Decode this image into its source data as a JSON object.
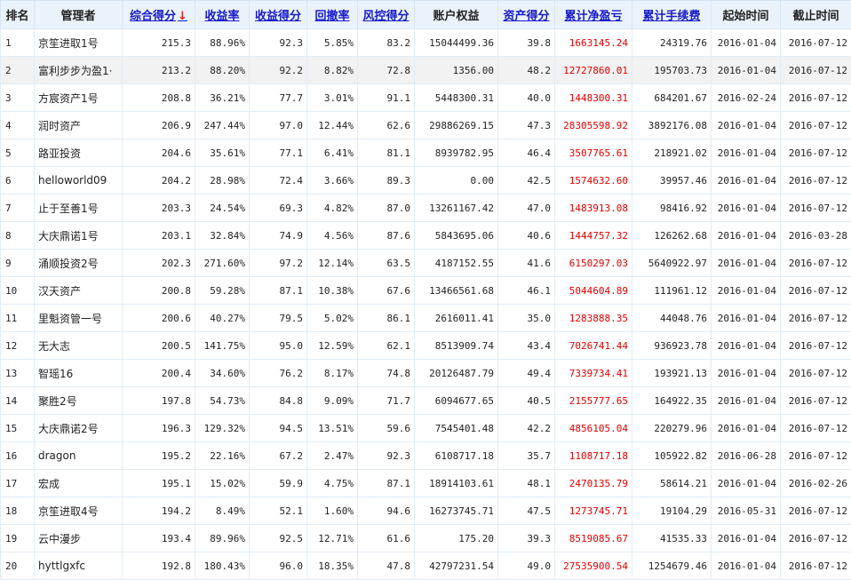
{
  "headers": {
    "rank": "排名",
    "manager": "管理者",
    "composite": "综合得分",
    "composite_arrow": "↓",
    "return_rate": "收益率",
    "return_score": "收益得分",
    "drawdown": "回撤率",
    "risk_score": "风控得分",
    "equity": "账户权益",
    "asset_score": "资产得分",
    "cum_pnl": "累计净盈亏",
    "cum_fee": "累计手续费",
    "start": "起始时间",
    "end": "截止时间"
  },
  "colors": {
    "header_bg": "#eaf3fc",
    "sort_link": "#1919c8",
    "arrow": "#e02020",
    "pnl_red": "#e00000",
    "highlight_row": "#f2f2f2"
  },
  "highlighted_row": 2,
  "rows": [
    {
      "rank": "1",
      "manager": "京笙进取1号",
      "composite": "215.3",
      "return_rate": "88.96%",
      "return_score": "92.3",
      "drawdown": "5.85%",
      "risk_score": "83.2",
      "equity": "15044499.36",
      "asset_score": "39.8",
      "cum_pnl": "1663145.24",
      "cum_fee": "24319.76",
      "start": "2016-01-04",
      "end": "2016-07-12"
    },
    {
      "rank": "2",
      "manager": "富利步步为盈1·",
      "composite": "213.2",
      "return_rate": "88.20%",
      "return_score": "92.2",
      "drawdown": "8.82%",
      "risk_score": "72.8",
      "equity": "1356.00",
      "asset_score": "48.2",
      "cum_pnl": "12727860.01",
      "cum_fee": "195703.73",
      "start": "2016-01-04",
      "end": "2016-07-12"
    },
    {
      "rank": "3",
      "manager": "方宸资产1号",
      "composite": "208.8",
      "return_rate": "36.21%",
      "return_score": "77.7",
      "drawdown": "3.01%",
      "risk_score": "91.1",
      "equity": "5448300.31",
      "asset_score": "40.0",
      "cum_pnl": "1448300.31",
      "cum_fee": "684201.67",
      "start": "2016-02-24",
      "end": "2016-07-12"
    },
    {
      "rank": "4",
      "manager": "润时资产",
      "composite": "206.9",
      "return_rate": "247.44%",
      "return_score": "97.0",
      "drawdown": "12.44%",
      "risk_score": "62.6",
      "equity": "29886269.15",
      "asset_score": "47.3",
      "cum_pnl": "28305598.92",
      "cum_fee": "3892176.08",
      "start": "2016-01-04",
      "end": "2016-07-12"
    },
    {
      "rank": "5",
      "manager": "路亚投资",
      "composite": "204.6",
      "return_rate": "35.61%",
      "return_score": "77.1",
      "drawdown": "6.41%",
      "risk_score": "81.1",
      "equity": "8939782.95",
      "asset_score": "46.4",
      "cum_pnl": "3507765.61",
      "cum_fee": "218921.02",
      "start": "2016-01-04",
      "end": "2016-07-12"
    },
    {
      "rank": "6",
      "manager": "helloworld09",
      "composite": "204.2",
      "return_rate": "28.98%",
      "return_score": "72.4",
      "drawdown": "3.66%",
      "risk_score": "89.3",
      "equity": "0.00",
      "asset_score": "42.5",
      "cum_pnl": "1574632.60",
      "cum_fee": "39957.46",
      "start": "2016-01-04",
      "end": "2016-07-12"
    },
    {
      "rank": "7",
      "manager": "止于至善1号",
      "composite": "203.3",
      "return_rate": "24.54%",
      "return_score": "69.3",
      "drawdown": "4.82%",
      "risk_score": "87.0",
      "equity": "13261167.42",
      "asset_score": "47.0",
      "cum_pnl": "1483913.08",
      "cum_fee": "98416.92",
      "start": "2016-01-04",
      "end": "2016-07-12"
    },
    {
      "rank": "8",
      "manager": "大庆鼎诺1号",
      "composite": "203.1",
      "return_rate": "32.84%",
      "return_score": "74.9",
      "drawdown": "4.56%",
      "risk_score": "87.6",
      "equity": "5843695.06",
      "asset_score": "40.6",
      "cum_pnl": "1444757.32",
      "cum_fee": "126262.68",
      "start": "2016-01-04",
      "end": "2016-03-28"
    },
    {
      "rank": "9",
      "manager": "涌顺投资2号",
      "composite": "202.3",
      "return_rate": "271.60%",
      "return_score": "97.2",
      "drawdown": "12.14%",
      "risk_score": "63.5",
      "equity": "4187152.55",
      "asset_score": "41.6",
      "cum_pnl": "6150297.03",
      "cum_fee": "5640922.97",
      "start": "2016-01-04",
      "end": "2016-07-12"
    },
    {
      "rank": "10",
      "manager": "汉天资产",
      "composite": "200.8",
      "return_rate": "59.28%",
      "return_score": "87.1",
      "drawdown": "10.38%",
      "risk_score": "67.6",
      "equity": "13466561.68",
      "asset_score": "46.1",
      "cum_pnl": "5044604.89",
      "cum_fee": "111961.12",
      "start": "2016-01-04",
      "end": "2016-07-12"
    },
    {
      "rank": "11",
      "manager": "里魁资管一号",
      "composite": "200.6",
      "return_rate": "40.27%",
      "return_score": "79.5",
      "drawdown": "5.02%",
      "risk_score": "86.1",
      "equity": "2616011.41",
      "asset_score": "35.0",
      "cum_pnl": "1283888.35",
      "cum_fee": "44048.76",
      "start": "2016-01-04",
      "end": "2016-07-12"
    },
    {
      "rank": "12",
      "manager": "无大志",
      "composite": "200.5",
      "return_rate": "141.75%",
      "return_score": "95.0",
      "drawdown": "12.59%",
      "risk_score": "62.1",
      "equity": "8513909.74",
      "asset_score": "43.4",
      "cum_pnl": "7026741.44",
      "cum_fee": "936923.78",
      "start": "2016-01-04",
      "end": "2016-07-12"
    },
    {
      "rank": "13",
      "manager": "智瑶16",
      "composite": "200.4",
      "return_rate": "34.60%",
      "return_score": "76.2",
      "drawdown": "8.17%",
      "risk_score": "74.8",
      "equity": "20126487.79",
      "asset_score": "49.4",
      "cum_pnl": "7339734.41",
      "cum_fee": "193921.13",
      "start": "2016-01-04",
      "end": "2016-07-12"
    },
    {
      "rank": "14",
      "manager": "聚胜2号",
      "composite": "197.8",
      "return_rate": "54.73%",
      "return_score": "84.8",
      "drawdown": "9.09%",
      "risk_score": "71.7",
      "equity": "6094677.65",
      "asset_score": "40.5",
      "cum_pnl": "2155777.65",
      "cum_fee": "164922.35",
      "start": "2016-01-04",
      "end": "2016-07-12"
    },
    {
      "rank": "15",
      "manager": "大庆鼎诺2号",
      "composite": "196.3",
      "return_rate": "129.32%",
      "return_score": "94.5",
      "drawdown": "13.51%",
      "risk_score": "59.6",
      "equity": "7545401.48",
      "asset_score": "42.2",
      "cum_pnl": "4856105.04",
      "cum_fee": "220279.96",
      "start": "2016-01-04",
      "end": "2016-07-12"
    },
    {
      "rank": "16",
      "manager": "dragon",
      "composite": "195.2",
      "return_rate": "22.16%",
      "return_score": "67.2",
      "drawdown": "2.47%",
      "risk_score": "92.3",
      "equity": "6108717.18",
      "asset_score": "35.7",
      "cum_pnl": "1108717.18",
      "cum_fee": "105922.82",
      "start": "2016-06-28",
      "end": "2016-07-12"
    },
    {
      "rank": "17",
      "manager": "宏成",
      "composite": "195.1",
      "return_rate": "15.02%",
      "return_score": "59.9",
      "drawdown": "4.75%",
      "risk_score": "87.1",
      "equity": "18914103.61",
      "asset_score": "48.1",
      "cum_pnl": "2470135.79",
      "cum_fee": "58614.21",
      "start": "2016-01-04",
      "end": "2016-02-26"
    },
    {
      "rank": "18",
      "manager": "京笙进取4号",
      "composite": "194.2",
      "return_rate": "8.49%",
      "return_score": "52.1",
      "drawdown": "1.60%",
      "risk_score": "94.6",
      "equity": "16273745.71",
      "asset_score": "47.5",
      "cum_pnl": "1273745.71",
      "cum_fee": "19104.29",
      "start": "2016-05-31",
      "end": "2016-07-12"
    },
    {
      "rank": "19",
      "manager": "云中漫步",
      "composite": "193.4",
      "return_rate": "89.96%",
      "return_score": "92.5",
      "drawdown": "12.71%",
      "risk_score": "61.6",
      "equity": "175.20",
      "asset_score": "39.3",
      "cum_pnl": "8519085.67",
      "cum_fee": "41535.33",
      "start": "2016-01-04",
      "end": "2016-07-12"
    },
    {
      "rank": "20",
      "manager": "hyttlgxfc",
      "composite": "192.8",
      "return_rate": "180.43%",
      "return_score": "96.0",
      "drawdown": "18.35%",
      "risk_score": "47.8",
      "equity": "42797231.54",
      "asset_score": "49.0",
      "cum_pnl": "27535900.54",
      "cum_fee": "1254679.46",
      "start": "2016-01-04",
      "end": "2016-07-12"
    }
  ]
}
